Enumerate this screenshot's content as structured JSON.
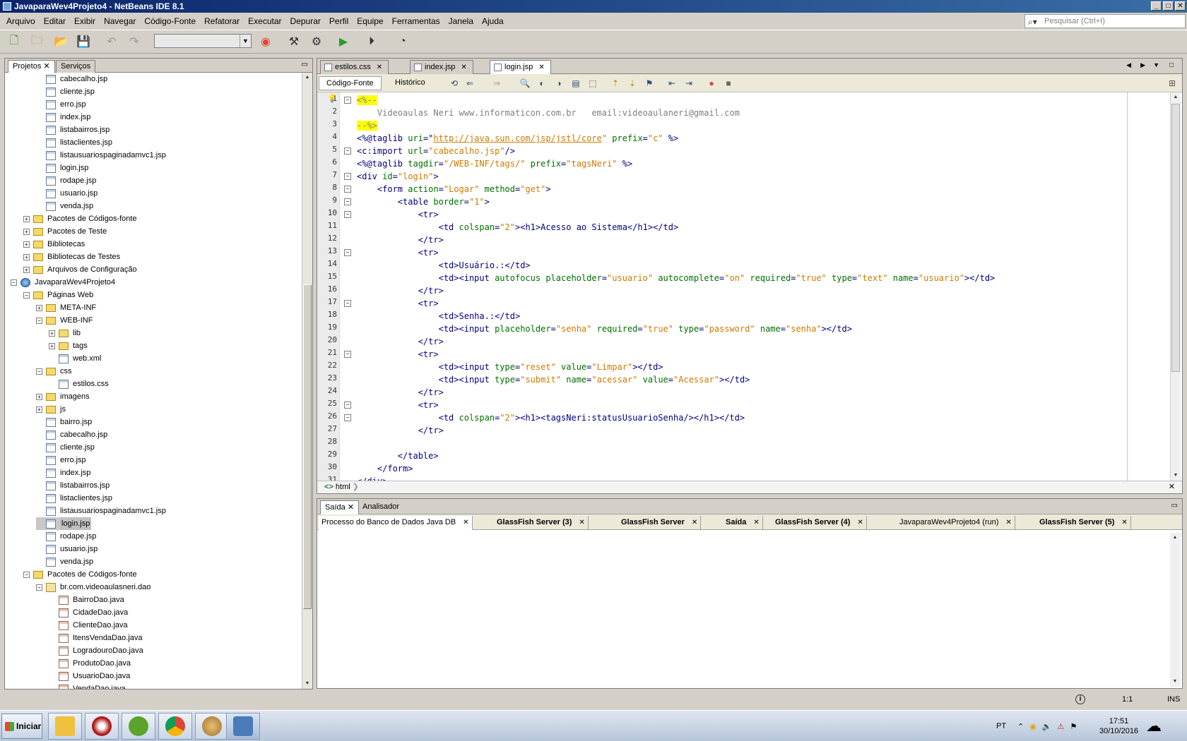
{
  "window": {
    "title": "JavaparaWev4Projeto4 - NetBeans IDE 8.1"
  },
  "menu": [
    "Arquivo",
    "Editar",
    "Exibir",
    "Navegar",
    "Código-Fonte",
    "Refatorar",
    "Executar",
    "Depurar",
    "Perfil",
    "Equipe",
    "Ferramentas",
    "Janela",
    "Ajuda"
  ],
  "search": {
    "placeholder": "Pesquisar (Ctrl+I)"
  },
  "leftpanel": {
    "tabs": [
      "Projetos",
      "Serviços"
    ],
    "tree": [
      {
        "label": "cabecalho.jsp",
        "indent": 3,
        "type": "file"
      },
      {
        "label": "cliente.jsp",
        "indent": 3,
        "type": "file"
      },
      {
        "label": "erro.jsp",
        "indent": 3,
        "type": "file"
      },
      {
        "label": "index.jsp",
        "indent": 3,
        "type": "file"
      },
      {
        "label": "listabairros.jsp",
        "indent": 3,
        "type": "file"
      },
      {
        "label": "listaclientes.jsp",
        "indent": 3,
        "type": "file"
      },
      {
        "label": "listausuariospaginadamvc1.jsp",
        "indent": 3,
        "type": "file"
      },
      {
        "label": "login.jsp",
        "indent": 3,
        "type": "file"
      },
      {
        "label": "rodape.jsp",
        "indent": 3,
        "type": "file"
      },
      {
        "label": "usuario.jsp",
        "indent": 3,
        "type": "file"
      },
      {
        "label": "venda.jsp",
        "indent": 3,
        "type": "file"
      },
      {
        "label": "Pacotes de Códigos-fonte",
        "indent": 2,
        "type": "folder",
        "exp": "+"
      },
      {
        "label": "Pacotes de Teste",
        "indent": 2,
        "type": "folder",
        "exp": "+"
      },
      {
        "label": "Bibliotecas",
        "indent": 2,
        "type": "folder",
        "exp": "+"
      },
      {
        "label": "Bibliotecas de Testes",
        "indent": 2,
        "type": "folder",
        "exp": "+"
      },
      {
        "label": "Arquivos de Configuração",
        "indent": 2,
        "type": "folder",
        "exp": "+"
      },
      {
        "label": "JavaparaWev4Projeto4",
        "indent": 1,
        "type": "globe",
        "exp": "−"
      },
      {
        "label": "Páginas Web",
        "indent": 2,
        "type": "folder",
        "exp": "−"
      },
      {
        "label": "META-INF",
        "indent": 3,
        "type": "folder",
        "exp": "+"
      },
      {
        "label": "WEB-INF",
        "indent": 3,
        "type": "folder",
        "exp": "−"
      },
      {
        "label": "lib",
        "indent": 4,
        "type": "folder",
        "exp": "+"
      },
      {
        "label": "tags",
        "indent": 4,
        "type": "folder",
        "exp": "+"
      },
      {
        "label": "web.xml",
        "indent": 4,
        "type": "file"
      },
      {
        "label": "css",
        "indent": 3,
        "type": "folder",
        "exp": "−"
      },
      {
        "label": "estilos.css",
        "indent": 4,
        "type": "file"
      },
      {
        "label": "imagens",
        "indent": 3,
        "type": "folder",
        "exp": "+"
      },
      {
        "label": "js",
        "indent": 3,
        "type": "folder",
        "exp": "+"
      },
      {
        "label": "bairro.jsp",
        "indent": 3,
        "type": "file"
      },
      {
        "label": "cabecalho.jsp",
        "indent": 3,
        "type": "file"
      },
      {
        "label": "cliente.jsp",
        "indent": 3,
        "type": "file"
      },
      {
        "label": "erro.jsp",
        "indent": 3,
        "type": "file"
      },
      {
        "label": "index.jsp",
        "indent": 3,
        "type": "file"
      },
      {
        "label": "listabairros.jsp",
        "indent": 3,
        "type": "file"
      },
      {
        "label": "listaclientes.jsp",
        "indent": 3,
        "type": "file"
      },
      {
        "label": "listausuariospaginadamvc1.jsp",
        "indent": 3,
        "type": "file"
      },
      {
        "label": "login.jsp",
        "indent": 3,
        "type": "file",
        "selected": true
      },
      {
        "label": "rodape.jsp",
        "indent": 3,
        "type": "file"
      },
      {
        "label": "usuario.jsp",
        "indent": 3,
        "type": "file"
      },
      {
        "label": "venda.jsp",
        "indent": 3,
        "type": "file"
      },
      {
        "label": "Pacotes de Códigos-fonte",
        "indent": 2,
        "type": "folder",
        "exp": "−"
      },
      {
        "label": "br.com.videoaulasneri.dao",
        "indent": 3,
        "type": "pkg",
        "exp": "−"
      },
      {
        "label": "BairroDao.java",
        "indent": 4,
        "type": "java"
      },
      {
        "label": "CidadeDao.java",
        "indent": 4,
        "type": "java"
      },
      {
        "label": "ClienteDao.java",
        "indent": 4,
        "type": "java"
      },
      {
        "label": "ItensVendaDao.java",
        "indent": 4,
        "type": "java"
      },
      {
        "label": "LogradouroDao.java",
        "indent": 4,
        "type": "java"
      },
      {
        "label": "ProdutoDao.java",
        "indent": 4,
        "type": "java"
      },
      {
        "label": "UsuarioDao.java",
        "indent": 4,
        "type": "java"
      },
      {
        "label": "VendaDao.java",
        "indent": 4,
        "type": "java"
      }
    ]
  },
  "editor": {
    "tabs": [
      "estilos.css",
      "index.jsp",
      "login.jsp"
    ],
    "active_tab": "login.jsp",
    "views": [
      "Código-Fonte",
      "Histórico"
    ],
    "breadcrumb": "html",
    "lines": [
      [
        {
          "t": "<%--",
          "c": "dlm"
        }
      ],
      [
        {
          "t": "    Videoaulas Neri www.informaticon.com.br   email:videoaulaneri@gmail.com",
          "c": "cm"
        }
      ],
      [
        {
          "t": "--%>",
          "c": "dlm"
        }
      ],
      [
        {
          "t": "<%@taglib ",
          "c": "tg"
        },
        {
          "t": "uri",
          "c": "at"
        },
        {
          "t": "=\"",
          "c": "tg"
        },
        {
          "t": "http://java.sun.com/jsp/jstl/core",
          "c": "lnk"
        },
        {
          "t": "\" ",
          "c": "va"
        },
        {
          "t": "prefix",
          "c": "at"
        },
        {
          "t": "=",
          "c": "tg"
        },
        {
          "t": "\"c\"",
          "c": "va"
        },
        {
          "t": " %>",
          "c": "tg"
        }
      ],
      [
        {
          "t": "<c:import ",
          "c": "tg"
        },
        {
          "t": "url",
          "c": "at"
        },
        {
          "t": "=",
          "c": "tg"
        },
        {
          "t": "\"cabecalho.jsp\"",
          "c": "va"
        },
        {
          "t": "/>",
          "c": "tg"
        }
      ],
      [
        {
          "t": "<%@taglib ",
          "c": "tg"
        },
        {
          "t": "tagdir",
          "c": "at"
        },
        {
          "t": "=",
          "c": "tg"
        },
        {
          "t": "\"/WEB-INF/tags/\"",
          "c": "va"
        },
        {
          "t": " ",
          "c": "tg"
        },
        {
          "t": "prefix",
          "c": "at"
        },
        {
          "t": "=",
          "c": "tg"
        },
        {
          "t": "\"tagsNeri\"",
          "c": "va"
        },
        {
          "t": " %>",
          "c": "tg"
        }
      ],
      [
        {
          "t": "<div ",
          "c": "tg"
        },
        {
          "t": "id",
          "c": "at"
        },
        {
          "t": "=",
          "c": "tg"
        },
        {
          "t": "\"login\"",
          "c": "va"
        },
        {
          "t": ">",
          "c": "tg"
        }
      ],
      [
        {
          "t": "    <form ",
          "c": "tg"
        },
        {
          "t": "action",
          "c": "at"
        },
        {
          "t": "=",
          "c": "tg"
        },
        {
          "t": "\"Logar\"",
          "c": "va"
        },
        {
          "t": " ",
          "c": "tg"
        },
        {
          "t": "method",
          "c": "at"
        },
        {
          "t": "=",
          "c": "tg"
        },
        {
          "t": "\"get\"",
          "c": "va"
        },
        {
          "t": ">",
          "c": "tg"
        }
      ],
      [
        {
          "t": "        <table ",
          "c": "tg"
        },
        {
          "t": "border",
          "c": "at"
        },
        {
          "t": "=",
          "c": "tg"
        },
        {
          "t": "\"1\"",
          "c": "va"
        },
        {
          "t": ">",
          "c": "tg"
        }
      ],
      [
        {
          "t": "            <tr>",
          "c": "tg"
        }
      ],
      [
        {
          "t": "                <td ",
          "c": "tg"
        },
        {
          "t": "colspan",
          "c": "at"
        },
        {
          "t": "=",
          "c": "tg"
        },
        {
          "t": "\"2\"",
          "c": "va"
        },
        {
          "t": "><h1>Acesso ao Sistema</h1></td>",
          "c": "tg"
        }
      ],
      [
        {
          "t": "            </tr>",
          "c": "tg"
        }
      ],
      [
        {
          "t": "            <tr>",
          "c": "tg"
        }
      ],
      [
        {
          "t": "                <td>Usuário.:</td>",
          "c": "tg"
        }
      ],
      [
        {
          "t": "                <td><input ",
          "c": "tg"
        },
        {
          "t": "autofocus ",
          "c": "at"
        },
        {
          "t": "placeholder",
          "c": "at"
        },
        {
          "t": "=",
          "c": "tg"
        },
        {
          "t": "\"usuario\"",
          "c": "va"
        },
        {
          "t": " ",
          "c": "tg"
        },
        {
          "t": "autocomplete",
          "c": "at"
        },
        {
          "t": "=",
          "c": "tg"
        },
        {
          "t": "\"on\"",
          "c": "va"
        },
        {
          "t": " ",
          "c": "tg"
        },
        {
          "t": "required",
          "c": "at"
        },
        {
          "t": "=",
          "c": "tg"
        },
        {
          "t": "\"true\"",
          "c": "va"
        },
        {
          "t": " ",
          "c": "tg"
        },
        {
          "t": "type",
          "c": "at"
        },
        {
          "t": "=",
          "c": "tg"
        },
        {
          "t": "\"text\"",
          "c": "va"
        },
        {
          "t": " ",
          "c": "tg"
        },
        {
          "t": "name",
          "c": "at"
        },
        {
          "t": "=",
          "c": "tg"
        },
        {
          "t": "\"usuario\"",
          "c": "va"
        },
        {
          "t": "></td>",
          "c": "tg"
        }
      ],
      [
        {
          "t": "            </tr>",
          "c": "tg"
        }
      ],
      [
        {
          "t": "            <tr>",
          "c": "tg"
        }
      ],
      [
        {
          "t": "                <td>Senha.:</td>",
          "c": "tg"
        }
      ],
      [
        {
          "t": "                <td><input ",
          "c": "tg"
        },
        {
          "t": "placeholder",
          "c": "at"
        },
        {
          "t": "=",
          "c": "tg"
        },
        {
          "t": "\"senha\"",
          "c": "va"
        },
        {
          "t": " ",
          "c": "tg"
        },
        {
          "t": "required",
          "c": "at"
        },
        {
          "t": "=",
          "c": "tg"
        },
        {
          "t": "\"true\"",
          "c": "va"
        },
        {
          "t": " ",
          "c": "tg"
        },
        {
          "t": "type",
          "c": "at"
        },
        {
          "t": "=",
          "c": "tg"
        },
        {
          "t": "\"password\"",
          "c": "va"
        },
        {
          "t": " ",
          "c": "tg"
        },
        {
          "t": "name",
          "c": "at"
        },
        {
          "t": "=",
          "c": "tg"
        },
        {
          "t": "\"senha\"",
          "c": "va"
        },
        {
          "t": "></td>",
          "c": "tg"
        }
      ],
      [
        {
          "t": "            </tr>",
          "c": "tg"
        }
      ],
      [
        {
          "t": "            <tr>",
          "c": "tg"
        }
      ],
      [
        {
          "t": "                <td><input ",
          "c": "tg"
        },
        {
          "t": "type",
          "c": "at"
        },
        {
          "t": "=",
          "c": "tg"
        },
        {
          "t": "\"reset\"",
          "c": "va"
        },
        {
          "t": " ",
          "c": "tg"
        },
        {
          "t": "value",
          "c": "at"
        },
        {
          "t": "=",
          "c": "tg"
        },
        {
          "t": "\"Limpar\"",
          "c": "va"
        },
        {
          "t": "></td>",
          "c": "tg"
        }
      ],
      [
        {
          "t": "                <td><input ",
          "c": "tg"
        },
        {
          "t": "type",
          "c": "at"
        },
        {
          "t": "=",
          "c": "tg"
        },
        {
          "t": "\"submit\"",
          "c": "va"
        },
        {
          "t": " ",
          "c": "tg"
        },
        {
          "t": "name",
          "c": "at"
        },
        {
          "t": "=",
          "c": "tg"
        },
        {
          "t": "\"acessar\"",
          "c": "va"
        },
        {
          "t": " ",
          "c": "tg"
        },
        {
          "t": "value",
          "c": "at"
        },
        {
          "t": "=",
          "c": "tg"
        },
        {
          "t": "\"Acessar\"",
          "c": "va"
        },
        {
          "t": "></td>",
          "c": "tg"
        }
      ],
      [
        {
          "t": "            </tr>",
          "c": "tg"
        }
      ],
      [
        {
          "t": "            <tr>",
          "c": "tg"
        }
      ],
      [
        {
          "t": "                <td ",
          "c": "tg"
        },
        {
          "t": "colspan",
          "c": "at"
        },
        {
          "t": "=",
          "c": "tg"
        },
        {
          "t": "\"2\"",
          "c": "va"
        },
        {
          "t": "><h1><tagsNeri:statusUsuarioSenha/></h1></td>",
          "c": "tg"
        }
      ],
      [
        {
          "t": "            </tr>",
          "c": "tg"
        }
      ],
      [
        {
          "t": "",
          "c": "tg"
        }
      ],
      [
        {
          "t": "        </table>",
          "c": "tg"
        }
      ],
      [
        {
          "t": "    </form>",
          "c": "tg"
        }
      ],
      [
        {
          "t": "</div>",
          "c": "tg"
        }
      ]
    ],
    "fold_lines": [
      1,
      5,
      7,
      8,
      9,
      10,
      13,
      17,
      21,
      25,
      26
    ]
  },
  "output": {
    "tabs": [
      "Saída",
      "Analisador"
    ],
    "processes": [
      {
        "label": "Processo do Banco de Dados Java DB",
        "bold": false,
        "active": true
      },
      {
        "label": "GlassFish Server (3)",
        "bold": true
      },
      {
        "label": "GlassFish Server",
        "bold": true
      },
      {
        "label": "Saída",
        "bold": true
      },
      {
        "label": "GlassFish Server (4)",
        "bold": true
      },
      {
        "label": "JavaparaWev4Projeto4 (run)",
        "bold": false
      },
      {
        "label": "GlassFish Server (5)",
        "bold": true
      }
    ]
  },
  "status": {
    "position": "1:1",
    "mode": "INS"
  },
  "taskbar": {
    "start": "Iniciar",
    "lang": "PT",
    "time": "17:51",
    "date": "30/10/2016"
  }
}
